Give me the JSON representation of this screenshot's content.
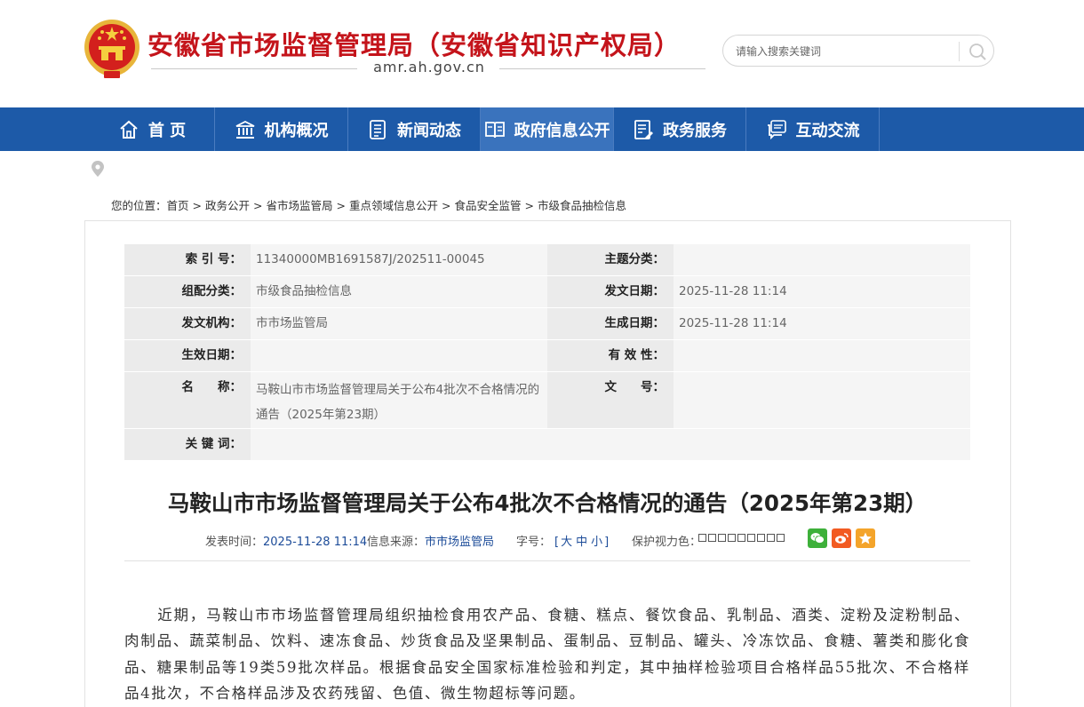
{
  "header": {
    "site_title": "安徽省市场监督管理局（安徽省知识产权局）",
    "domain": "amr.ah.gov.cn",
    "search_placeholder": "请输入搜索关键词"
  },
  "nav": [
    {
      "label": "首 页",
      "icon": "home-icon"
    },
    {
      "label": "机构概况",
      "icon": "building-icon"
    },
    {
      "label": "新闻动态",
      "icon": "news-icon"
    },
    {
      "label": "政府信息公开",
      "icon": "book-icon",
      "active": true
    },
    {
      "label": "政务服务",
      "icon": "document-icon"
    },
    {
      "label": "互动交流",
      "icon": "chat-icon"
    }
  ],
  "breadcrumb": {
    "prefix": "您的位置：",
    "items": [
      "首页",
      "政务公开",
      "省市场监管局",
      "重点领域信息公开",
      "食品安全监管",
      "市级食品抽检信息"
    ],
    "separator": ">"
  },
  "meta": {
    "index_label": "索 引 号：",
    "index_value": "11340000MB1691587J/202511-00045",
    "topic_label": "主题分类：",
    "topic_value": "",
    "group_label": "组配分类：",
    "group_value": "市级食品抽检信息",
    "pubdate_label": "发文日期：",
    "pubdate_value": "2025-11-28 11:14",
    "issuer_label": "发文机构：",
    "issuer_value": "市市场监管局",
    "gendate_label": "生成日期：",
    "gendate_value": "2025-11-28 11:14",
    "effective_label": "生效日期：",
    "effective_value": "",
    "validity_label": "有 效 性：",
    "validity_value": "",
    "name_label": "名　　称：",
    "name_value_line1": "马鞍山市市场监督管理局关于公布4批次不合格情况的",
    "name_value_line2": "通告（2025年第23期）",
    "docno_label": "文　　号：",
    "docno_value": "",
    "keywords_label": "关 键 词：",
    "keywords_value": ""
  },
  "article": {
    "title": "马鞍山市市场监督管理局关于公布4批次不合格情况的通告（2025年第23期）",
    "pub_time_label": "发表时间：",
    "pub_time": "2025-11-28 11:14",
    "source_label": "信息来源：",
    "source": "市市场监管局",
    "font_size_label": "字号：",
    "font_size_open": "[",
    "font_large": "大",
    "font_medium": "中",
    "font_small": "小",
    "font_size_close": "]",
    "eye_protect_label": "保护视力色：",
    "body": "近期，马鞍山市市场监督管理局组织抽检食用农产品、食糖、糕点、餐饮食品、乳制品、酒类、淀粉及淀粉制品、肉制品、蔬菜制品、饮料、速冻食品、炒货食品及坚果制品、蛋制品、豆制品、罐头、冷冻饮品、食糖、薯类和膨化食品、糖果制品等19类59批次样品。根据食品安全国家标准检验和判定，其中抽样检验项目合格样品55批次、不合格样品4批次，不合格样品涉及农药残留、色值、微生物超标等问题。"
  },
  "colors": {
    "brand_red": "#c4141b",
    "nav_blue": "#1d5aa8",
    "nav_active": "#3a73bd",
    "link_blue": "#1d4c99",
    "wechat_green": "#3db03a",
    "weibo_orange": "#f25b22",
    "favorite_orange": "#f4a42a"
  }
}
